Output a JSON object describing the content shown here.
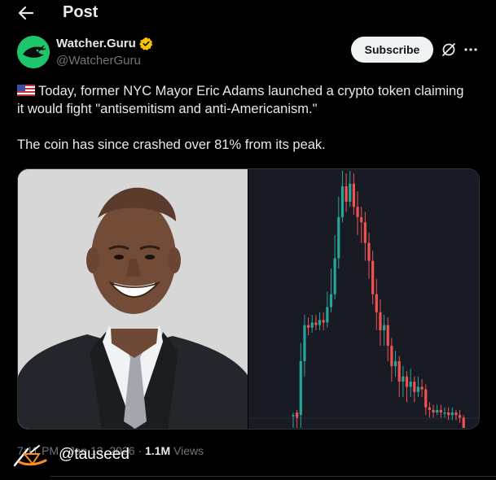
{
  "header": {
    "title": "Post"
  },
  "author": {
    "name": "Watcher.Guru",
    "handle": "@WatcherGuru"
  },
  "actions": {
    "subscribe_label": "Subscribe"
  },
  "icons": {
    "back": "back-arrow-icon",
    "verified": "verified-badge-icon",
    "grok": "grok-icon",
    "more": "more-options-icon",
    "flag": "us-flag-icon"
  },
  "tweet": {
    "paragraph1": "Today, former NYC Mayor Eric Adams launched a crypto token claiming it would fight \"antisemitism and anti-Americanism.\"",
    "paragraph2": "The coin has since crashed over 81% from its peak."
  },
  "meta": {
    "time": "7:11 PM",
    "date": "Jan 13, 2026",
    "separator1": "·",
    "separator2": "·",
    "views_count": "1.1M",
    "views_label": "Views"
  },
  "watermark": {
    "text": "@tauseed"
  },
  "colors": {
    "background": "#000000",
    "text": "#e7e9ea",
    "muted": "#71767b",
    "verified": "#f4c300",
    "avatar": "#1ec66b",
    "candle_up": "#26a69a",
    "candle_down": "#ef5350",
    "chart_bg": "#181b24"
  },
  "chart_data": {
    "type": "candlestick",
    "candles": [
      {
        "o": 5,
        "c": 5,
        "h": 6,
        "l": 0
      },
      {
        "o": 6,
        "c": 4,
        "h": 7,
        "l": 0
      },
      {
        "o": 5,
        "c": 26,
        "h": 33,
        "l": 0
      },
      {
        "o": 26,
        "c": 40,
        "h": 44,
        "l": 20
      },
      {
        "o": 40,
        "c": 39,
        "h": 43,
        "l": 36
      },
      {
        "o": 39,
        "c": 41,
        "h": 44,
        "l": 37
      },
      {
        "o": 41,
        "c": 40,
        "h": 44,
        "l": 38
      },
      {
        "o": 40,
        "c": 42,
        "h": 45,
        "l": 38
      },
      {
        "o": 42,
        "c": 41,
        "h": 45,
        "l": 38
      },
      {
        "o": 41,
        "c": 47,
        "h": 53,
        "l": 39
      },
      {
        "o": 47,
        "c": 52,
        "h": 62,
        "l": 45
      },
      {
        "o": 52,
        "c": 66,
        "h": 75,
        "l": 50
      },
      {
        "o": 66,
        "c": 82,
        "h": 90,
        "l": 62
      },
      {
        "o": 82,
        "c": 94,
        "h": 100,
        "l": 80
      },
      {
        "o": 94,
        "c": 88,
        "h": 99,
        "l": 84
      },
      {
        "o": 88,
        "c": 95,
        "h": 100,
        "l": 86
      },
      {
        "o": 95,
        "c": 86,
        "h": 99,
        "l": 83
      },
      {
        "o": 86,
        "c": 82,
        "h": 92,
        "l": 75
      },
      {
        "o": 82,
        "c": 80,
        "h": 86,
        "l": 72
      },
      {
        "o": 80,
        "c": 72,
        "h": 84,
        "l": 65
      },
      {
        "o": 72,
        "c": 65,
        "h": 76,
        "l": 58
      },
      {
        "o": 65,
        "c": 52,
        "h": 69,
        "l": 48
      },
      {
        "o": 52,
        "c": 45,
        "h": 58,
        "l": 38
      },
      {
        "o": 45,
        "c": 38,
        "h": 50,
        "l": 32
      },
      {
        "o": 38,
        "c": 40,
        "h": 44,
        "l": 32
      },
      {
        "o": 40,
        "c": 32,
        "h": 43,
        "l": 26
      },
      {
        "o": 32,
        "c": 24,
        "h": 35,
        "l": 18
      },
      {
        "o": 24,
        "c": 26,
        "h": 30,
        "l": 20
      },
      {
        "o": 26,
        "c": 18,
        "h": 28,
        "l": 12
      },
      {
        "o": 18,
        "c": 20,
        "h": 24,
        "l": 12
      },
      {
        "o": 20,
        "c": 16,
        "h": 22,
        "l": 10
      },
      {
        "o": 16,
        "c": 18,
        "h": 23,
        "l": 12
      },
      {
        "o": 18,
        "c": 14,
        "h": 20,
        "l": 10
      },
      {
        "o": 14,
        "c": 16,
        "h": 20,
        "l": 12
      },
      {
        "o": 16,
        "c": 15,
        "h": 19,
        "l": 12
      },
      {
        "o": 15,
        "c": 8,
        "h": 17,
        "l": 5
      },
      {
        "o": 8,
        "c": 7,
        "h": 10,
        "l": 4
      },
      {
        "o": 7,
        "c": 6,
        "h": 9,
        "l": 4
      },
      {
        "o": 6,
        "c": 7,
        "h": 9,
        "l": 5
      },
      {
        "o": 7,
        "c": 6,
        "h": 9,
        "l": 4
      },
      {
        "o": 6,
        "c": 6,
        "h": 8,
        "l": 4
      },
      {
        "o": 6,
        "c": 5,
        "h": 8,
        "l": 3
      },
      {
        "o": 5,
        "c": 6,
        "h": 8,
        "l": 3
      },
      {
        "o": 6,
        "c": 5,
        "h": 7,
        "l": 3
      },
      {
        "o": 5,
        "c": 4,
        "h": 7,
        "l": 2
      },
      {
        "o": 4,
        "c": 0,
        "h": 5,
        "l": 0
      }
    ]
  }
}
